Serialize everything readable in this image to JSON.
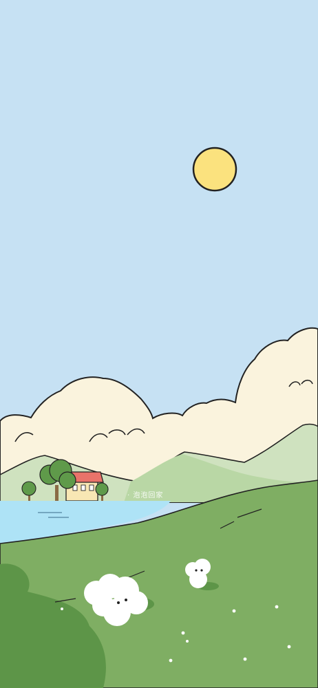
{
  "scene": {
    "title": "",
    "watermark": "· 泡泡回家",
    "colors": {
      "sky": "#c6e1f3",
      "sun": "#fbe27e",
      "clouds": "#faf3dd",
      "far_hills": "#cfe2bf",
      "lake": "#aee3f6",
      "meadow": "#7fae63",
      "meadow_dark": "#5d9548",
      "roof": "#e9736a",
      "house_wall": "#f8e7b4",
      "tree": "#5f9a4a",
      "outline": "#222222"
    }
  }
}
